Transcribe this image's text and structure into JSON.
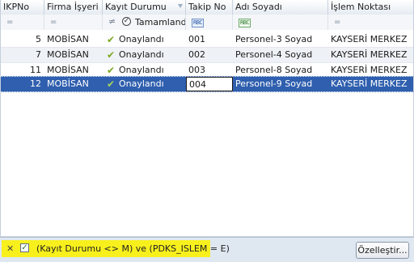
{
  "columns": {
    "ikpno": "IKPNo",
    "firma": "Firma İşyeri",
    "kayit": "Kayıt Durumu",
    "takip": "Takip No",
    "adi": "Adı Soyadı",
    "islem": "İşlem Noktası"
  },
  "filter_row": {
    "ikpno_op": "=",
    "firma_op": "=",
    "kayit_op": "≠",
    "kayit_value": "Tamamlandı",
    "takip_icon": "RBC",
    "adi_icon": "RBC",
    "islem_op": "="
  },
  "rows": [
    {
      "ikpno": "5",
      "firma": "MOBİSAN",
      "kayit": "Onaylandı",
      "takip": "001",
      "adi": "Personel-3 Soyad",
      "islem": "KAYSERİ MERKEZ"
    },
    {
      "ikpno": "7",
      "firma": "MOBİSAN",
      "kayit": "Onaylandı",
      "takip": "002",
      "adi": "Personel-4 Soyad",
      "islem": "KAYSERİ MERKEZ"
    },
    {
      "ikpno": "11",
      "firma": "MOBİSAN",
      "kayit": "Onaylandı",
      "takip": "003",
      "adi": "Personel-8 Soyad",
      "islem": "KAYSERİ MERKEZ"
    },
    {
      "ikpno": "12",
      "firma": "MOBİSAN",
      "kayit": "Onaylandı",
      "takip": "004",
      "adi": "Personel-9 Soyad",
      "islem": "KAYSERİ MERKEZ"
    }
  ],
  "selected_row_index": 3,
  "filter_panel": {
    "close_glyph": "✕",
    "check_glyph": "✓",
    "expression": "(Kayıt Durumu <> M) ve (PDKS_ISLEM = E)",
    "customize_label": "Özelleştir..."
  },
  "colors": {
    "selection": "#2f5fae",
    "filter_highlight": "#f8f01c",
    "check_green": "#7aa820"
  }
}
